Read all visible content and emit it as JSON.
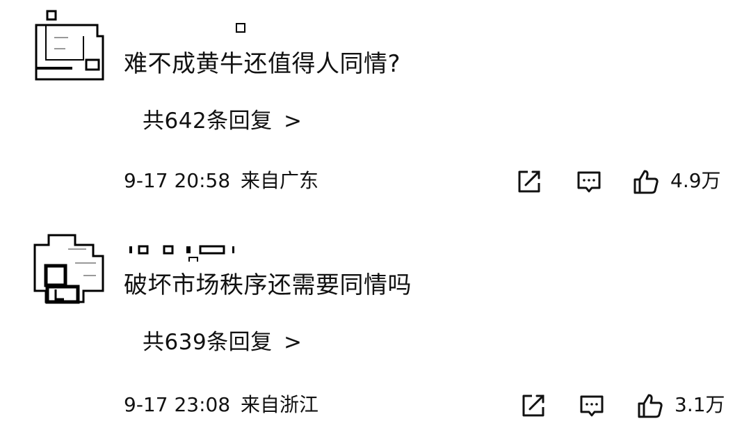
{
  "comments": [
    {
      "text": "难不成黄牛还值得人同情?",
      "replies": {
        "prefix": "共",
        "count": "642",
        "suffix": "条回复"
      },
      "timestamp": "9-17 20:58",
      "location": "来自广东",
      "likes": "4.9万"
    },
    {
      "text": "破坏市场秩序还需要同情吗",
      "replies": {
        "prefix": "共",
        "count": "639",
        "suffix": "条回复"
      },
      "timestamp": "9-17 23:08",
      "location": "来自浙江",
      "likes": "3.1万"
    }
  ],
  "icons": {
    "share": "share-icon",
    "reply": "comment-icon",
    "like": "thumbs-up-icon",
    "chevron": "chevron-right-icon"
  },
  "chevron_glyph": ">"
}
